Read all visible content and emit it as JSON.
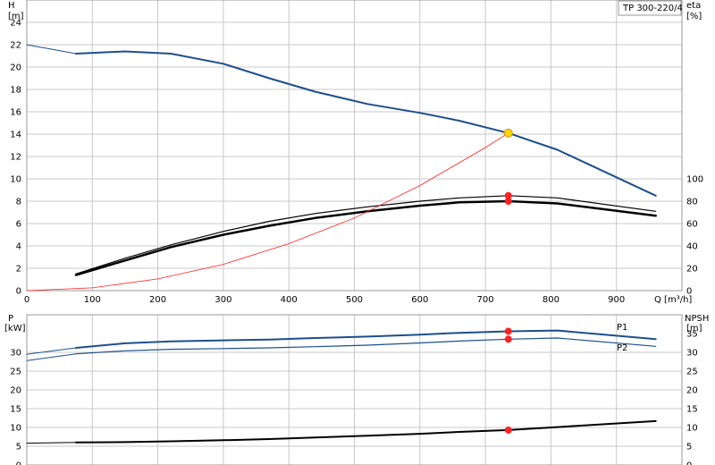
{
  "chart_data": [
    {
      "type": "line",
      "title": "TP 300-220/4",
      "xlabel": "Q [m³/h]",
      "ylabel_left_top": "H",
      "ylabel_left_unit": "[m]",
      "ylabel_right_top": "eta",
      "ylabel_right_unit": "[%]",
      "xlim": [
        0,
        1000
      ],
      "x_ticks": [
        0,
        100,
        200,
        300,
        400,
        500,
        600,
        700,
        800,
        900
      ],
      "ylim_left": [
        0,
        26
      ],
      "y_ticks_left": [
        0,
        2,
        4,
        6,
        8,
        10,
        12,
        14,
        16,
        18,
        20,
        22,
        24
      ],
      "ylim_right": [
        0,
        260
      ],
      "y_ticks_right": [
        0,
        20,
        40,
        60,
        80,
        100
      ],
      "grid": true,
      "series": [
        {
          "key": "H",
          "axis": "left",
          "color": "#1c4f8c",
          "width": 2,
          "x": [
            75,
            150,
            220,
            300,
            370,
            440,
            520,
            600,
            660,
            735,
            810,
            960
          ],
          "y": [
            21.2,
            21.4,
            21.2,
            20.3,
            19.0,
            17.8,
            16.7,
            15.9,
            15.2,
            14.1,
            12.6,
            8.5
          ]
        },
        {
          "key": "H_ext",
          "axis": "left",
          "color": "#1c4f8c",
          "width": 1,
          "x": [
            0,
            75
          ],
          "y": [
            22.0,
            21.2
          ]
        },
        {
          "key": "eta_upper",
          "axis": "right",
          "color": "#000000",
          "width": 1.2,
          "x": [
            75,
            150,
            220,
            300,
            370,
            440,
            520,
            600,
            660,
            735,
            810,
            960
          ],
          "y": [
            15,
            29,
            41,
            53,
            62,
            69,
            75,
            80,
            83,
            85,
            83,
            71
          ]
        },
        {
          "key": "eta_lower",
          "axis": "right",
          "color": "#000000",
          "width": 2.5,
          "x": [
            75,
            150,
            220,
            300,
            370,
            440,
            520,
            600,
            660,
            735,
            810,
            960
          ],
          "y": [
            14,
            27,
            39,
            50,
            58,
            65,
            71,
            76,
            79,
            80,
            78,
            67
          ]
        },
        {
          "key": "system_curve",
          "axis": "left",
          "color": "#ff2020",
          "width": 0.8,
          "x": [
            0,
            100,
            200,
            300,
            400,
            500,
            600,
            700,
            735
          ],
          "y": [
            0,
            0.25,
            1.05,
            2.35,
            4.2,
            6.5,
            9.4,
            12.8,
            14.1
          ]
        }
      ],
      "markers": [
        {
          "axis": "left",
          "x": 735,
          "y": 14.1,
          "fill": "#ffd500",
          "stroke": "#e0901a",
          "r": 4.5
        },
        {
          "axis": "right",
          "x": 735,
          "y": 85,
          "fill": "#ff2020",
          "stroke": "#ff2020",
          "r": 3.5
        },
        {
          "axis": "right",
          "x": 735,
          "y": 80,
          "fill": "#ff2020",
          "stroke": "#ff2020",
          "r": 3.5
        }
      ]
    },
    {
      "type": "line",
      "ylabel_left_top": "P",
      "ylabel_left_unit": "[kW]",
      "ylabel_right_top": "NPSH",
      "ylabel_right_unit": "[m]",
      "xlim": [
        0,
        1000
      ],
      "ylim_left": [
        0,
        40
      ],
      "y_ticks_left": [
        0,
        5,
        10,
        15,
        20,
        25,
        30
      ],
      "ylim_right": [
        0,
        40
      ],
      "y_ticks_right": [
        0,
        5,
        10,
        15,
        20,
        25,
        30,
        35
      ],
      "grid": true,
      "series": [
        {
          "key": "P1",
          "name": "P1",
          "axis": "left",
          "color": "#1c4f8c",
          "width": 2,
          "x": [
            75,
            150,
            220,
            300,
            370,
            440,
            520,
            600,
            660,
            735,
            810,
            960
          ],
          "y": [
            31.2,
            32.4,
            32.9,
            33.2,
            33.4,
            33.8,
            34.2,
            34.7,
            35.2,
            35.6,
            35.8,
            33.5
          ]
        },
        {
          "key": "P1_ext",
          "axis": "left",
          "color": "#1c4f8c",
          "width": 1,
          "x": [
            0,
            75
          ],
          "y": [
            29.5,
            31.2
          ]
        },
        {
          "key": "P2",
          "name": "P2",
          "axis": "left",
          "color": "#1c4f8c",
          "width": 1.2,
          "x": [
            75,
            150,
            220,
            300,
            370,
            440,
            520,
            600,
            660,
            735,
            810,
            960
          ],
          "y": [
            29.6,
            30.4,
            30.8,
            31.0,
            31.2,
            31.5,
            31.9,
            32.5,
            33.0,
            33.5,
            33.8,
            31.6
          ]
        },
        {
          "key": "P2_ext",
          "axis": "left",
          "color": "#1c4f8c",
          "width": 1,
          "x": [
            0,
            75
          ],
          "y": [
            27.8,
            29.6
          ]
        },
        {
          "key": "NPSH",
          "axis": "right",
          "color": "#000000",
          "width": 2,
          "x": [
            75,
            150,
            220,
            300,
            370,
            440,
            520,
            600,
            660,
            735,
            810,
            960
          ],
          "y": [
            6.0,
            6.1,
            6.3,
            6.6,
            6.9,
            7.3,
            7.8,
            8.3,
            8.8,
            9.3,
            10.1,
            11.7
          ]
        },
        {
          "key": "NPSH_ext",
          "axis": "right",
          "color": "#000000",
          "width": 1,
          "x": [
            0,
            75
          ],
          "y": [
            5.8,
            6.0
          ]
        }
      ],
      "markers": [
        {
          "axis": "left",
          "x": 735,
          "y": 35.6,
          "fill": "#ff2020",
          "stroke": "#ff2020",
          "r": 3.5
        },
        {
          "axis": "left",
          "x": 735,
          "y": 33.5,
          "fill": "#ff2020",
          "stroke": "#ff2020",
          "r": 3.5
        },
        {
          "axis": "right",
          "x": 735,
          "y": 9.3,
          "fill": "#ff2020",
          "stroke": "#ff2020",
          "r": 3.5
        }
      ]
    }
  ]
}
